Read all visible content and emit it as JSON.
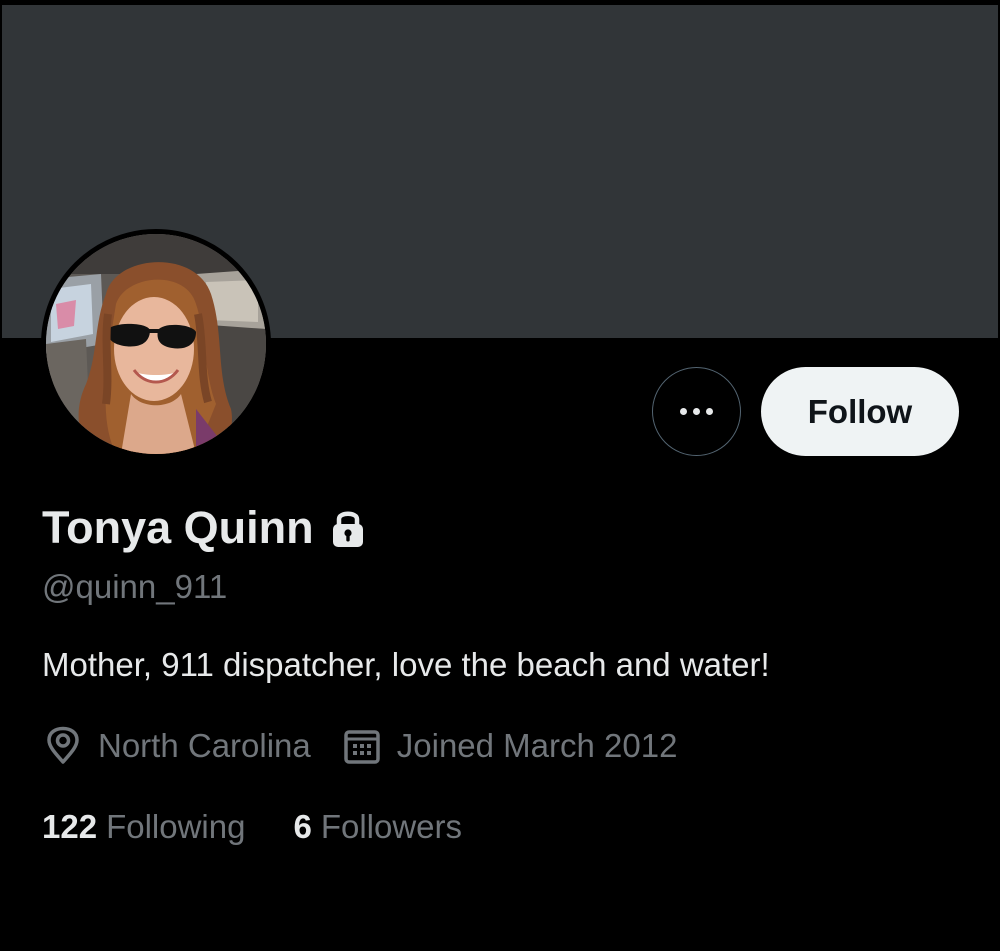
{
  "profile": {
    "display_name": "Tonya Quinn",
    "handle": "@quinn_911",
    "bio": "Mother, 911 dispatcher, love the beach and water!",
    "location": "North Carolina",
    "joined": "Joined March 2012",
    "protected_icon": "lock-icon",
    "location_icon": "map-pin-icon",
    "joined_icon": "calendar-icon"
  },
  "actions": {
    "more_icon": "more-options-icon",
    "follow_label": "Follow"
  },
  "stats": {
    "following_count": "122",
    "following_label": "Following",
    "followers_count": "6",
    "followers_label": "Followers"
  },
  "colors": {
    "background": "#000000",
    "banner": "#313538",
    "primary_text": "#e7e9ea",
    "secondary_text": "#71767b",
    "follow_button_bg": "#eff3f4",
    "follow_button_text": "#0f1419",
    "outline": "#536471"
  }
}
